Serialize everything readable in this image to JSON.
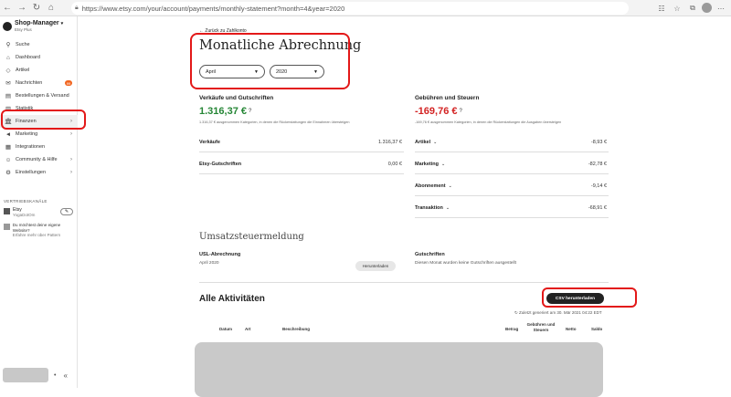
{
  "browser": {
    "url": "https://www.etsy.com/your/account/payments/monthly-statement?month=4&year=2020"
  },
  "sidebar": {
    "shop_title": "Shop-Manager",
    "shop_sub": "Etsy Plus",
    "items": [
      {
        "label": "Suche",
        "icon": "search-icon"
      },
      {
        "label": "Dashboard",
        "icon": "home-icon"
      },
      {
        "label": "Artikel",
        "icon": "tag-icon"
      },
      {
        "label": "Nachrichten",
        "icon": "mail-icon",
        "badge": "99"
      },
      {
        "label": "Bestellungen & Versand",
        "icon": "receipt-icon"
      },
      {
        "label": "Statistik",
        "icon": "chart-icon"
      },
      {
        "label": "Finanzen",
        "icon": "bank-icon",
        "active": true
      },
      {
        "label": "Marketing",
        "icon": "megaphone-icon"
      },
      {
        "label": "Integrationen",
        "icon": "grid-icon"
      },
      {
        "label": "Community & Hilfe",
        "icon": "people-icon"
      },
      {
        "label": "Einstellungen",
        "icon": "gear-icon"
      }
    ],
    "channels_label": "VERTRIEBSKANÄLE",
    "channel_name": "Etsy",
    "channel_sub": "YogaDotOm",
    "promo_text": "Du möchtest deine eigene Website?",
    "promo_link": "Erfahre mehr über Pattern"
  },
  "main": {
    "back_link": "Zurück zu Zahlkonto",
    "title": "Monatliche Abrechnung",
    "month": "April",
    "year": "2020",
    "sales": {
      "heading": "Verkäufe und Gutschriften",
      "total": "1.316,37 €",
      "note": "1.316,37 € ausgenommen Kategorien, in denen die Rückerstattungen die Einnahmen übersteigen",
      "rows": [
        {
          "label": "Verkäufe",
          "value": "1.316,37 €"
        },
        {
          "label": "Etsy-Gutschriften",
          "value": "0,00 €"
        }
      ]
    },
    "fees": {
      "heading": "Gebühren und Steuern",
      "total": "-169,76 €",
      "note": "-169,76 € ausgenommen Kategorien, in denen die Rückerstattungen die Ausgaben übersteigen",
      "rows": [
        {
          "label": "Artikel",
          "value": "-8,93 €"
        },
        {
          "label": "Marketing",
          "value": "-82,78 €"
        },
        {
          "label": "Abonnement",
          "value": "-9,14 €"
        },
        {
          "label": "Transaktion",
          "value": "-68,91 €"
        }
      ]
    },
    "vat": {
      "title": "Umsatzsteuermeldung",
      "usl_label": "USL-Abrechnung",
      "usl_period": "April 2020",
      "download": "Herunterladen",
      "credits_label": "Gutschriften",
      "credits_text": "Diesen Monat wurden keine Gutschriften ausgestellt"
    },
    "activities": {
      "title": "Alle Aktivitäten",
      "csv_button": "CSV herunterladen",
      "generated": "Zuletzt generiert am 30. Mär 2021 04:22 EDT",
      "columns": [
        "Datum",
        "Art",
        "Beschreibung",
        "Betrag",
        "Gebühren und Steuern",
        "Netto",
        "Saldo"
      ]
    }
  }
}
